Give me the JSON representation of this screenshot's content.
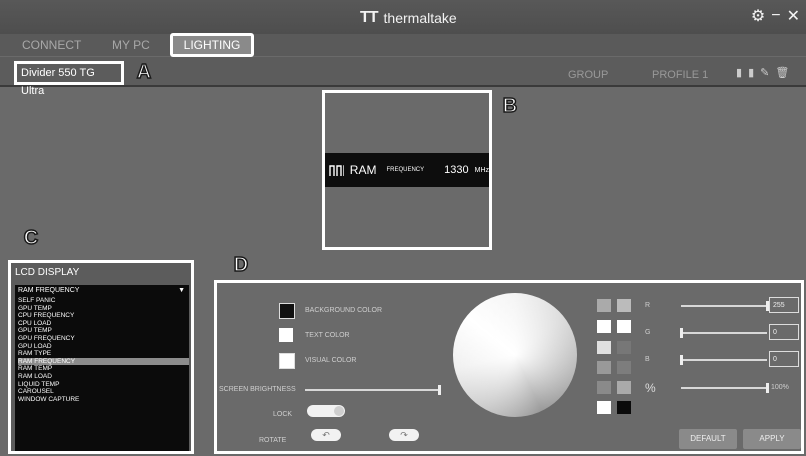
{
  "app": {
    "brand": "thermaltake",
    "logo_glyph": "TT"
  },
  "window_controls": {
    "settings": "⚙",
    "minimize": "−",
    "close": "✕"
  },
  "tabs": [
    {
      "label": "CONNECT"
    },
    {
      "label": "MY PC"
    },
    {
      "label": "LIGHTING",
      "active": true
    }
  ],
  "device": {
    "name": "Divider 550 TG Ultra"
  },
  "group": {
    "label": "GROUP"
  },
  "profile": {
    "label": "PROFILE 1",
    "icons": [
      "save-icon",
      "load-icon",
      "edit-icon",
      "delete-icon"
    ]
  },
  "callouts": {
    "a": "A",
    "b": "B",
    "c": "C",
    "d": "D"
  },
  "preview": {
    "icon": "ram-icon",
    "name": "RAM",
    "metric": "FREQUENCY",
    "value": "1330",
    "unit": "MHz"
  },
  "lcd_display": {
    "title": "LCD DISPLAY",
    "selected": "RAM FREQUENCY",
    "options": [
      "SELF PANIC",
      "GPU TEMP",
      "CPU FREQUENCY",
      "CPU LOAD",
      "GPU TEMP",
      "GPU FREQUENCY",
      "GPU LOAD",
      "RAM TYPE",
      "RAM FREQUENCY",
      "RAM TEMP",
      "RAM LOAD",
      "LIQUID TEMP",
      "CAROUSEL",
      "WINDOW CAPTURE"
    ]
  },
  "colors": {
    "background_label": "BACKGROUND COLOR",
    "text_label": "TEXT COLOR",
    "visual_label": "VISUAL COLOR",
    "background_swatch": "#111111",
    "text_swatch": "#ffffff",
    "visual_swatch": "#ffffff"
  },
  "brightness": {
    "label": "SCREEN BRIGHTNESS",
    "value": 1.0
  },
  "lock": {
    "label": "LOCK"
  },
  "rotate": {
    "label": "ROTATE"
  },
  "rgb": {
    "r_label": "R",
    "g_label": "G",
    "b_label": "B",
    "r_value": "255",
    "g_value": "0",
    "b_value": "0",
    "percent_label": "%",
    "percent_value": "100%",
    "r": 1.0,
    "g": 0.0,
    "b": 0.0,
    "percent": 1.0
  },
  "buttons": {
    "default": "DEFAULT",
    "apply": "APPLY"
  }
}
